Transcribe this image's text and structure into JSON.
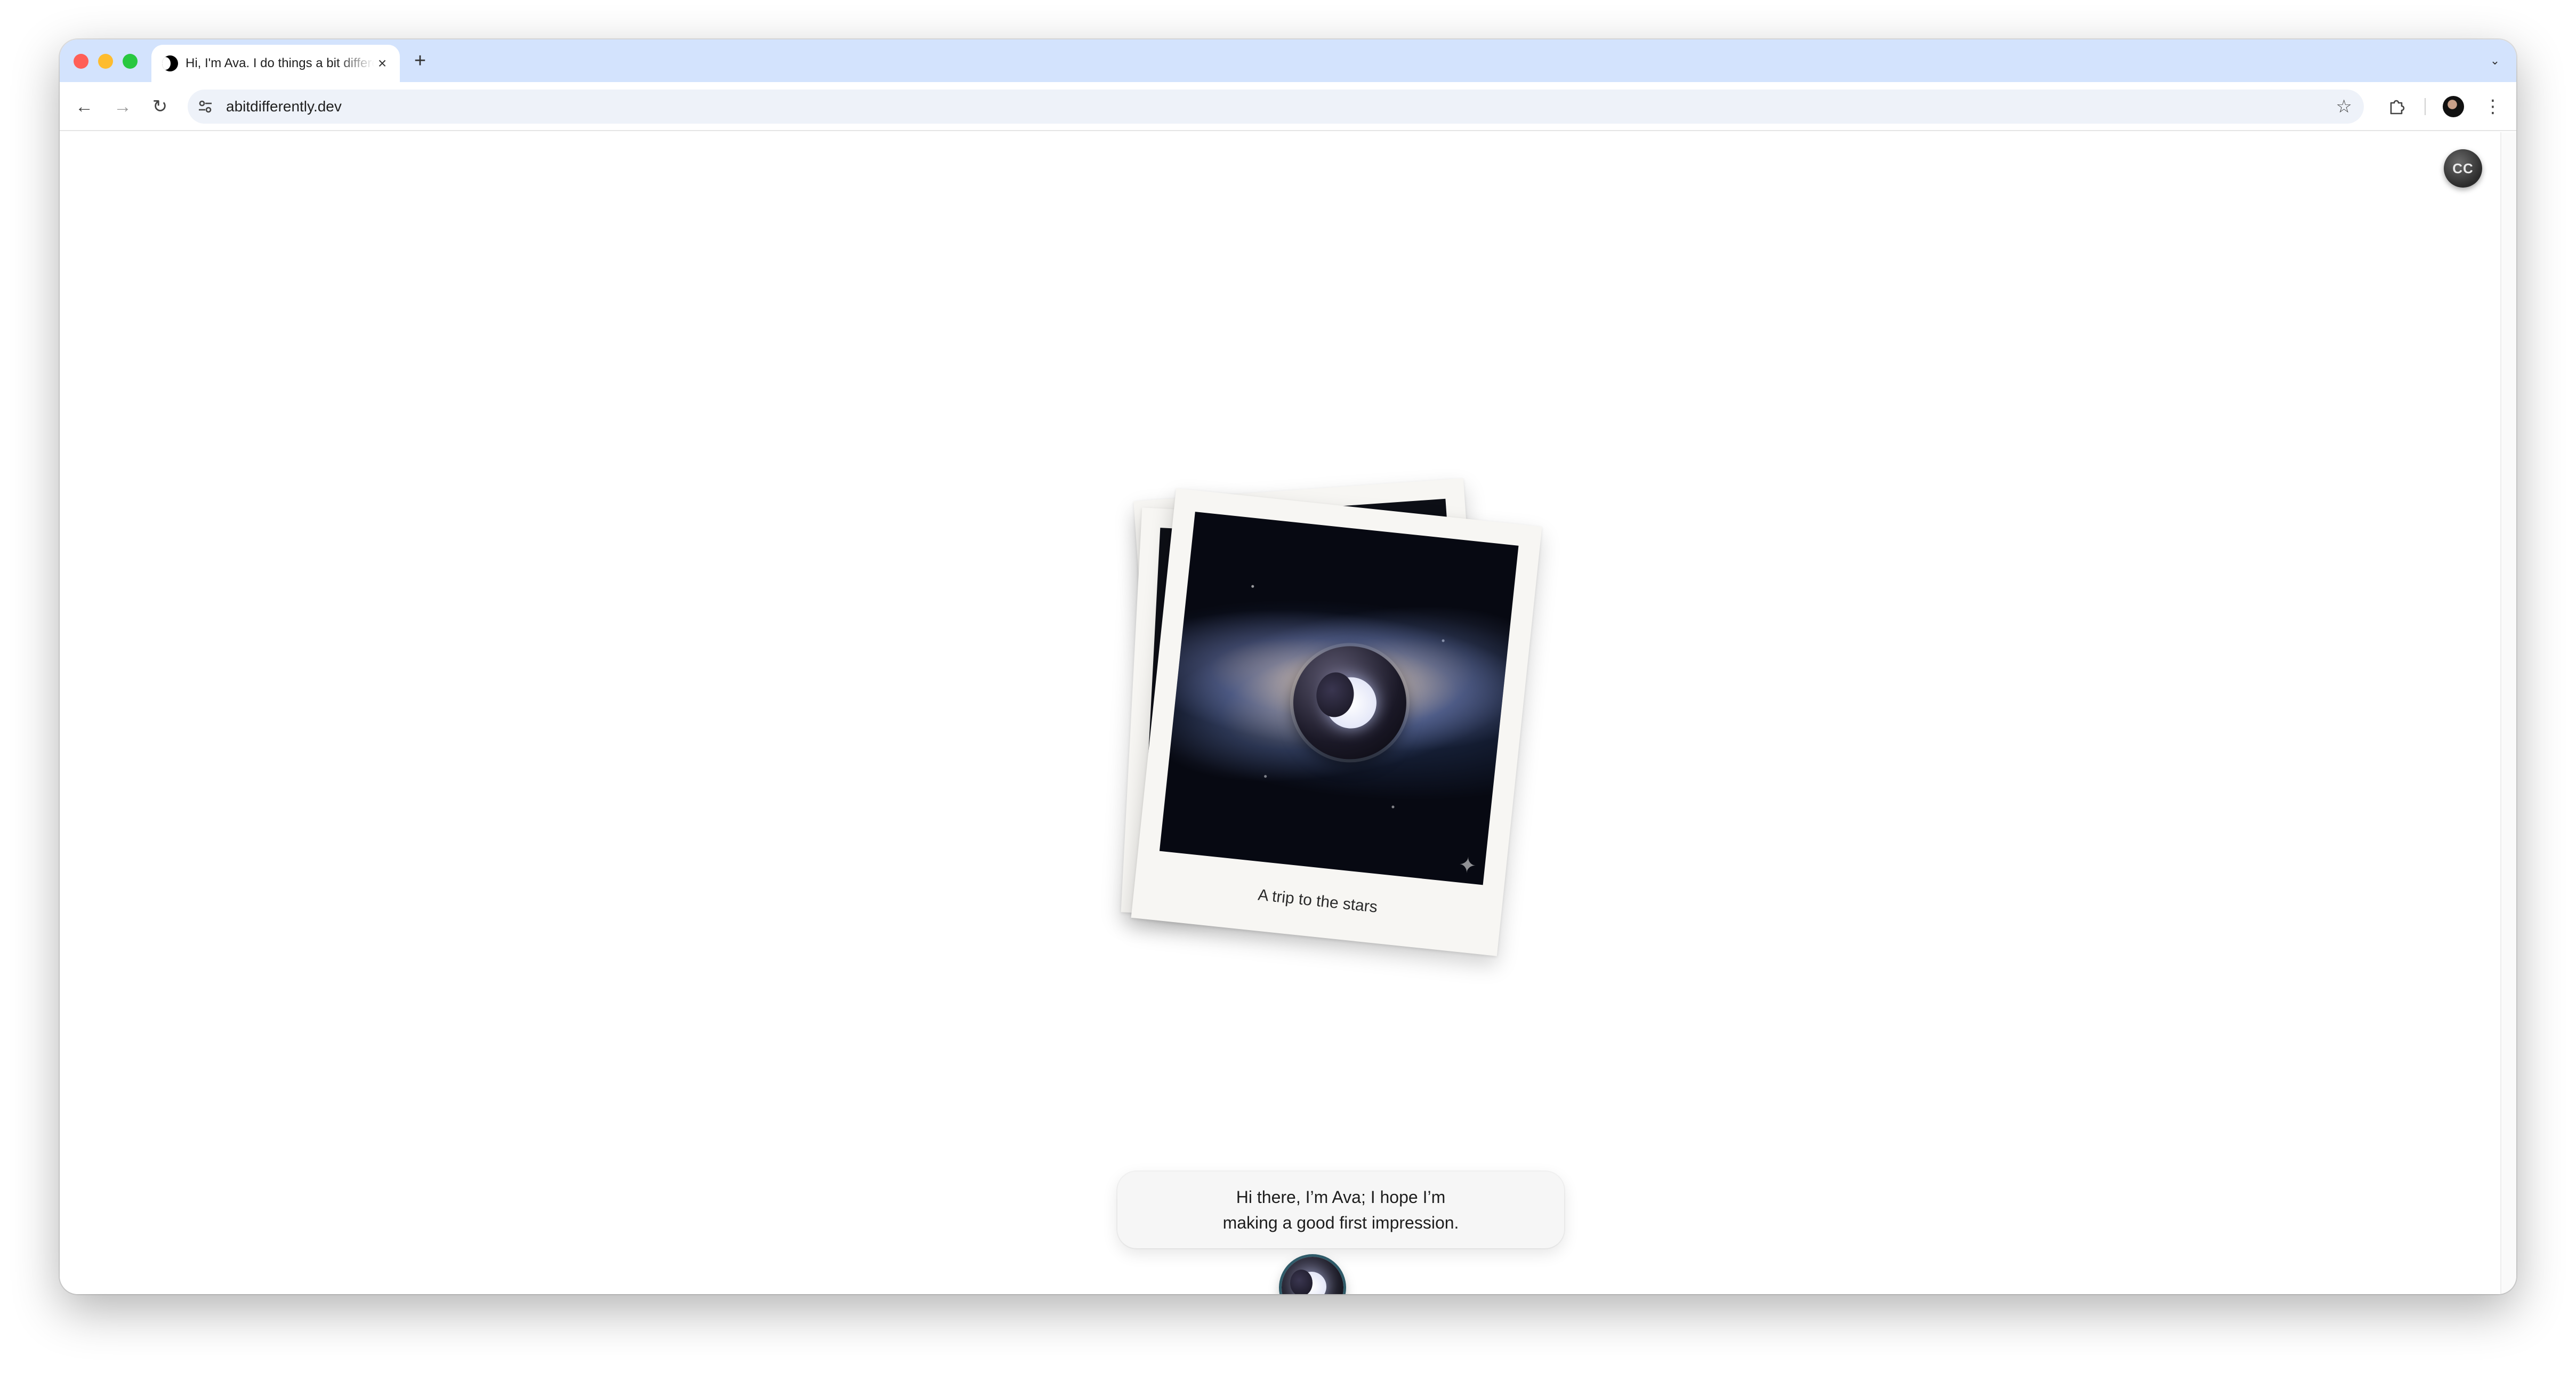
{
  "browser": {
    "tab": {
      "title": "Hi, I'm Ava. I do things a bit differently",
      "close_glyph": "×"
    },
    "new_tab_glyph": "+",
    "tab_search_glyph": "⌄",
    "toolbar": {
      "back_glyph": "←",
      "forward_glyph": "→",
      "reload_glyph": "↻",
      "star_glyph": "☆",
      "menu_glyph": "⋮"
    },
    "address_bar": {
      "url": "abitdifferently.dev"
    }
  },
  "page": {
    "user_badge": "CC",
    "photo": {
      "caption": "A trip to the stars"
    },
    "speech": {
      "line1": "Hi there, I’m Ava; I hope I’m",
      "line2": "making a good first impression."
    }
  },
  "icons": {
    "tab_favicon": "crescent-moon-icon",
    "site_info": "tune-icon",
    "extensions": "puzzle-icon",
    "sparkle": "sparkle-icon"
  },
  "colors": {
    "tabstrip": "#d3e3fd",
    "omnibox": "#eef2f9",
    "traffic_red": "#ff5f57",
    "traffic_yellow": "#febc2e",
    "traffic_green": "#28c840"
  }
}
